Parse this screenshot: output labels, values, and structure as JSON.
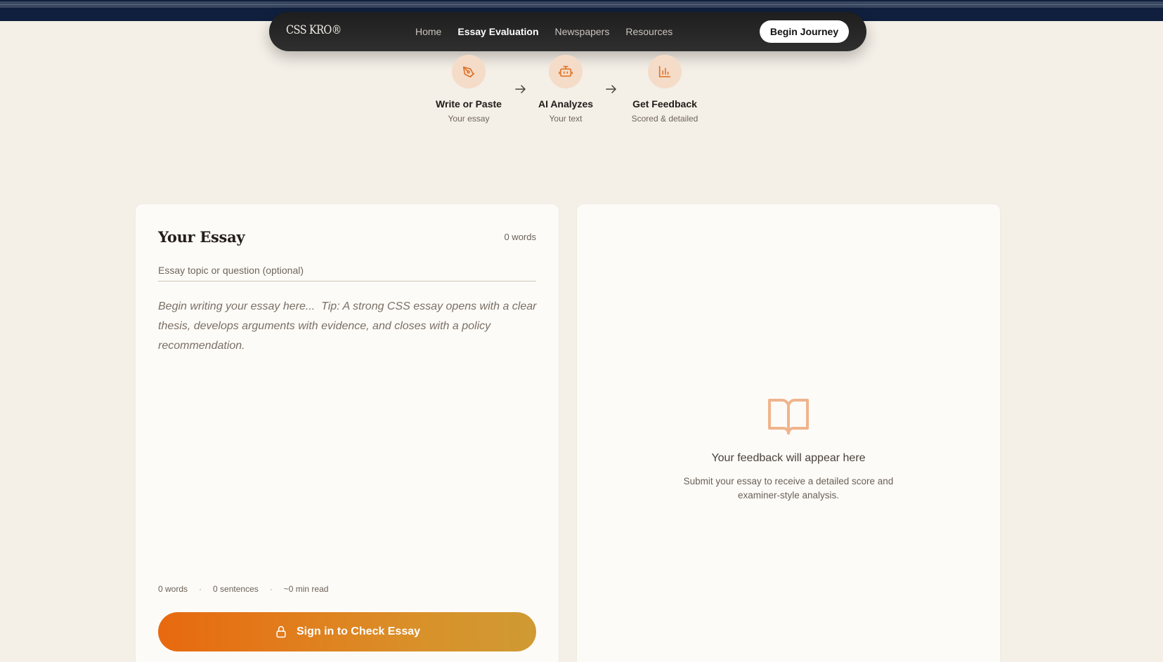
{
  "nav": {
    "logo": "CSS KRO®",
    "links": [
      {
        "label": "Home",
        "active": false
      },
      {
        "label": "Essay Evaluation",
        "active": true
      },
      {
        "label": "Newspapers",
        "active": false
      },
      {
        "label": "Resources",
        "active": false
      }
    ],
    "cta_label": "Begin Journey"
  },
  "steps": [
    {
      "title": "Write or Paste",
      "subtitle": "Your essay",
      "icon": "pen-nib-icon"
    },
    {
      "title": "AI Analyzes",
      "subtitle": "Your text",
      "icon": "robot-icon"
    },
    {
      "title": "Get Feedback",
      "subtitle": "Scored & detailed",
      "icon": "bar-chart-icon"
    }
  ],
  "essay": {
    "title": "Your Essay",
    "word_count_label": "0 words",
    "topic_value": "",
    "topic_placeholder": "Essay topic or question (optional)",
    "body_value": "",
    "body_placeholder": "Begin writing your essay here...  Tip: A strong CSS essay opens with a clear thesis, develops arguments with evidence, and closes with a policy recommendation.",
    "stats": {
      "words": "0 words",
      "separator": "·",
      "sentences": "0 sentences",
      "read_time": "~0 min read"
    },
    "submit_label": "Sign in to Check Essay"
  },
  "feedback": {
    "title": "Your feedback will appear here",
    "subtitle": "Submit your essay to receive a detailed score and examiner-style analysis."
  },
  "colors": {
    "background": "#f4efe7",
    "navbar": "#2a2a2a",
    "top_band": "#0f1f3d",
    "accent_orange": "#e8690f",
    "accent_gold": "#cf9a34",
    "icon_bg": "#f5dcc8"
  }
}
